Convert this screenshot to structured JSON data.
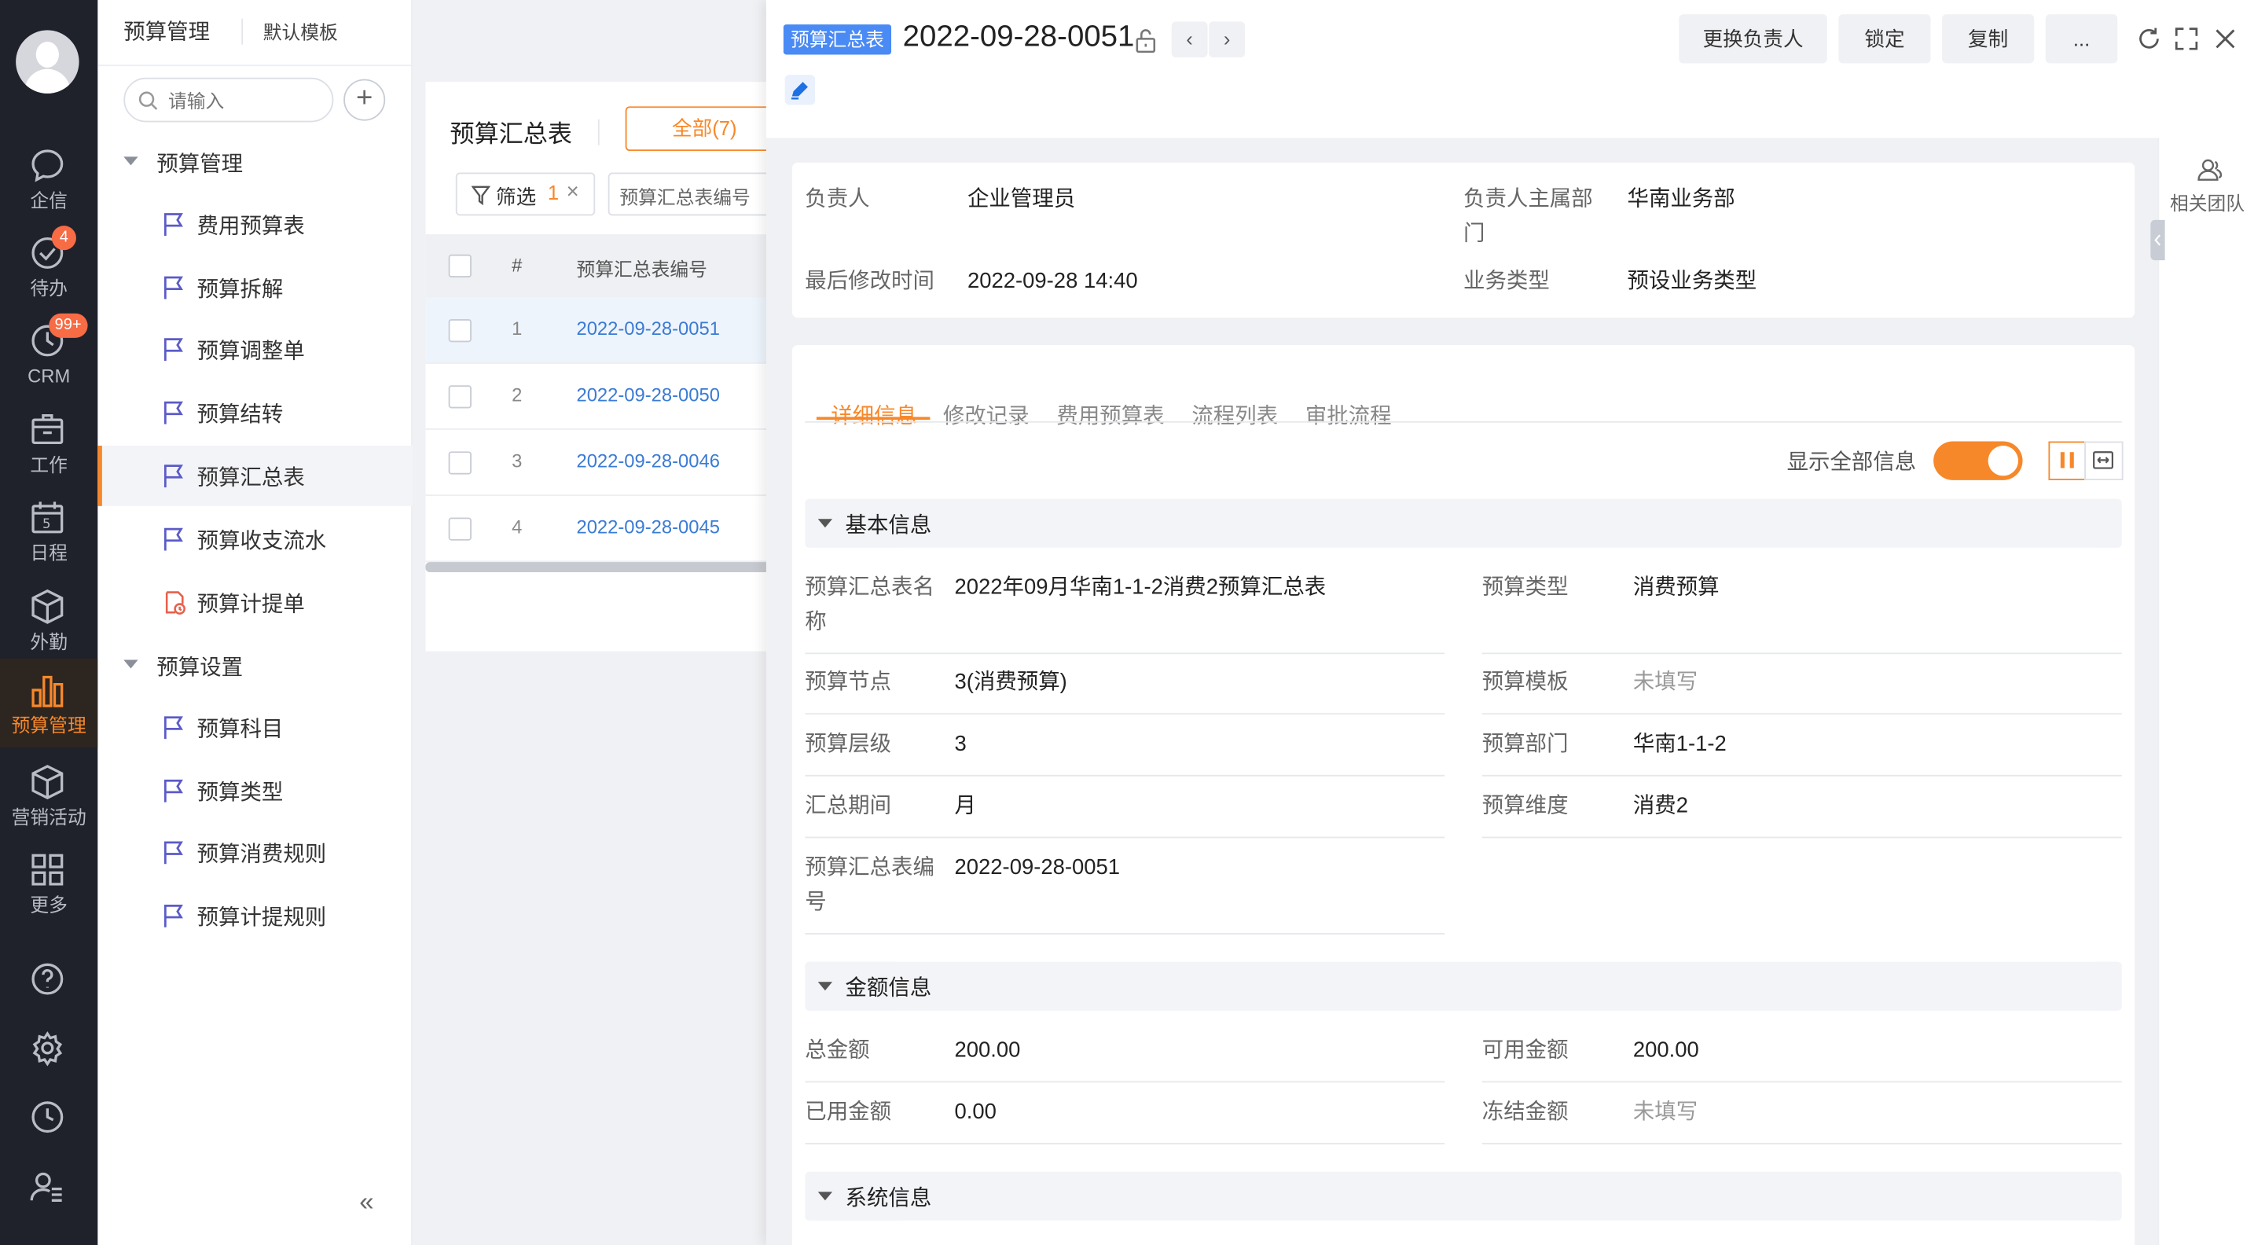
{
  "rail": {
    "items": [
      {
        "label": "企信"
      },
      {
        "label": "待办",
        "badge": "4"
      },
      {
        "label": "CRM",
        "badge": "99+"
      },
      {
        "label": "工作"
      },
      {
        "label": "日程",
        "icon_text": "5"
      },
      {
        "label": "外勤"
      },
      {
        "label": "预算管理"
      },
      {
        "label": "营销活动"
      },
      {
        "label": "更多"
      }
    ]
  },
  "nav": {
    "title": "预算管理",
    "template": "默认模板",
    "search_placeholder": "请输入",
    "add": "+",
    "groups": [
      {
        "label": "预算管理",
        "items": [
          "费用预算表",
          "预算拆解",
          "预算调整单",
          "预算结转",
          "预算汇总表",
          "预算收支流水",
          "预算计提单"
        ]
      },
      {
        "label": "预算设置",
        "items": [
          "预算科目",
          "预算类型",
          "预算消费规则",
          "预算计提规则"
        ]
      }
    ],
    "active_item": "预算汇总表",
    "collapse": "«"
  },
  "list": {
    "title": "预算汇总表",
    "all_label": "全部(7)",
    "filter_label": "筛选",
    "filter_count": "1",
    "filter_clear": "×",
    "field_label": "预算汇总表编号",
    "columns": {
      "index": "#",
      "code": "预算汇总表编号"
    },
    "rows": [
      {
        "index": "1",
        "code": "2022-09-28-0051"
      },
      {
        "index": "2",
        "code": "2022-09-28-0050"
      },
      {
        "index": "3",
        "code": "2022-09-28-0046"
      },
      {
        "index": "4",
        "code": "2022-09-28-0045"
      }
    ]
  },
  "detail": {
    "tag": "预算汇总表",
    "code": "2022-09-28-0051",
    "prev": "‹",
    "next": "›",
    "actions": {
      "change_owner": "更换负责人",
      "lock": "锁定",
      "copy": "复制",
      "more": "..."
    },
    "summary": {
      "owner_label": "负责人",
      "owner": "企业管理员",
      "dept_label": "负责人主属部门",
      "dept": "华南业务部",
      "modified_label": "最后修改时间",
      "modified": "2022-09-28 14:40",
      "biz_type_label": "业务类型",
      "biz_type": "预设业务类型"
    },
    "tabs": [
      "详细信息",
      "修改记录",
      "费用预算表",
      "流程列表",
      "审批流程"
    ],
    "show_all_label": "显示全部信息",
    "show_all_on": true,
    "sections": {
      "basic": {
        "title": "基本信息",
        "fields": [
          {
            "label": "预算汇总表名称",
            "value": "2022年09月华南1-1-2消费2预算汇总表"
          },
          {
            "label": "预算类型",
            "value": "消费预算"
          },
          {
            "label": "预算节点",
            "value": "3(消费预算)"
          },
          {
            "label": "预算模板",
            "value": "未填写"
          },
          {
            "label": "预算层级",
            "value": "3"
          },
          {
            "label": "预算部门",
            "value": "华南1-1-2"
          },
          {
            "label": "汇总期间",
            "value": "月"
          },
          {
            "label": "预算维度",
            "value": "消费2"
          },
          {
            "label": "预算汇总表编号",
            "value": "2022-09-28-0051"
          }
        ]
      },
      "amount": {
        "title": "金额信息",
        "fields": [
          {
            "label": "总金额",
            "value": "200.00"
          },
          {
            "label": "可用金额",
            "value": "200.00"
          },
          {
            "label": "已用金额",
            "value": "0.00"
          },
          {
            "label": "冻结金额",
            "value": "未填写"
          }
        ]
      },
      "system": {
        "title": "系统信息"
      }
    },
    "side": {
      "team_label": "相关团队"
    }
  },
  "colors": {
    "accent": "#f7882a",
    "link": "#3a7bd5",
    "tag": "#4a8af4",
    "rail": "#1f222b",
    "badge": "#f76b45"
  }
}
